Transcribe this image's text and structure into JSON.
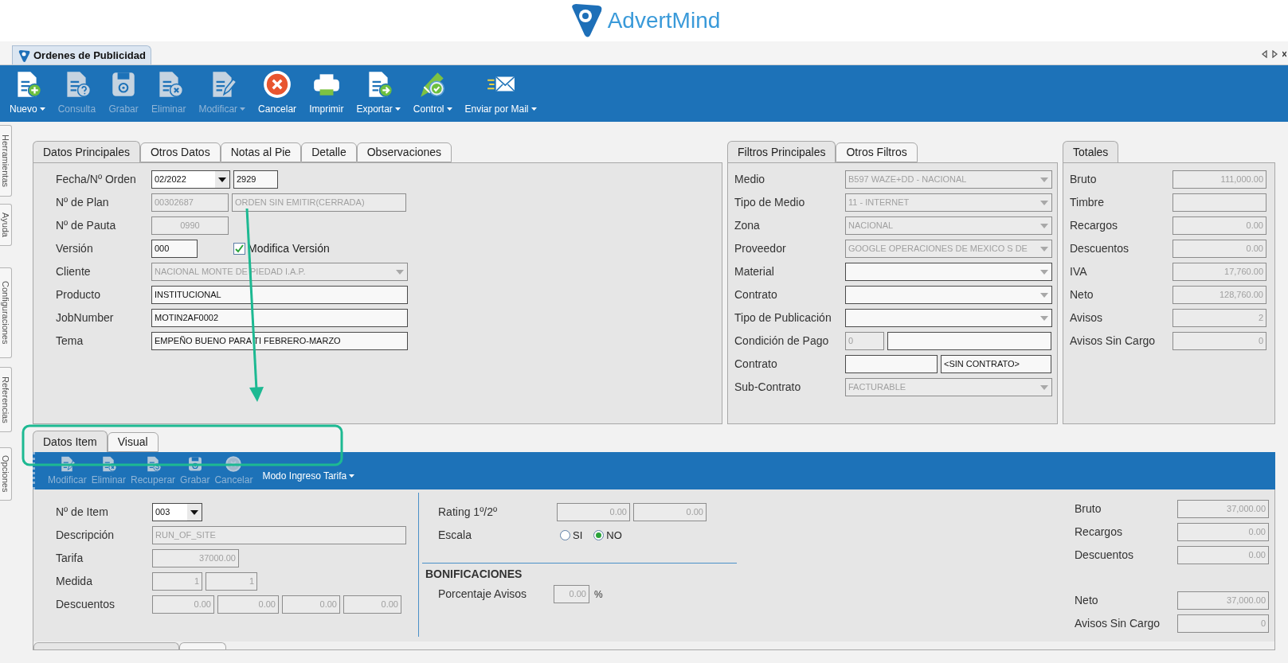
{
  "header": {
    "logo": "AdvertMind"
  },
  "document_tab": {
    "title": "Ordenes de Publicidad"
  },
  "toolbar": [
    {
      "label": "Nuevo",
      "kind": "new",
      "disabled": false,
      "dropdown": true
    },
    {
      "label": "Consulta",
      "kind": "query",
      "disabled": true,
      "dropdown": false
    },
    {
      "label": "Grabar",
      "kind": "save",
      "disabled": true,
      "dropdown": false
    },
    {
      "label": "Eliminar",
      "kind": "delete",
      "disabled": true,
      "dropdown": false
    },
    {
      "label": "Modificar",
      "kind": "edit",
      "disabled": true,
      "dropdown": true
    },
    {
      "label": "Cancelar",
      "kind": "cancel",
      "disabled": false,
      "dropdown": false
    },
    {
      "label": "Imprimir",
      "kind": "print",
      "disabled": false,
      "dropdown": false
    },
    {
      "label": "Exportar",
      "kind": "export",
      "disabled": false,
      "dropdown": true
    },
    {
      "label": "Control",
      "kind": "control",
      "disabled": false,
      "dropdown": true
    },
    {
      "label": "Enviar por Mail",
      "kind": "mail",
      "disabled": false,
      "dropdown": true
    }
  ],
  "side_tabs": [
    "Herramientas",
    "Ayuda",
    "Configuraciones",
    "Referencias",
    "Opciones"
  ],
  "main_panel": {
    "tabs": [
      {
        "label": "Datos Principales",
        "selected": true
      },
      {
        "label": "Otros Datos",
        "selected": false
      },
      {
        "label": "Notas al Pie",
        "selected": false
      },
      {
        "label": "Detalle",
        "selected": false
      },
      {
        "label": "Observaciones",
        "selected": false
      }
    ],
    "rows": [
      {
        "label": "Fecha/Nº Orden",
        "fields": [
          {
            "value": "02/2022",
            "kind": "combo",
            "disabled": false
          },
          {
            "value": "2929",
            "kind": "text",
            "disabled": false
          }
        ]
      },
      {
        "label": "Nº de Plan",
        "fields": [
          {
            "value": "00302687",
            "kind": "text",
            "disabled": true
          },
          {
            "value": "ORDEN SIN EMITIR(CERRADA)",
            "kind": "text",
            "disabled": true
          }
        ]
      },
      {
        "label": "Nº de Pauta",
        "fields": [
          {
            "value": "0990",
            "kind": "code",
            "disabled": true
          }
        ]
      },
      {
        "label": "Versión",
        "fields": [
          {
            "value": "000",
            "kind": "text",
            "disabled": false
          }
        ],
        "checkbox": {
          "label": "Modifica Versión",
          "checked": true
        }
      },
      {
        "label": "Cliente",
        "fields": [
          {
            "value": "NACIONAL MONTE DE PIEDAD I.A.P.",
            "kind": "select",
            "disabled": true
          }
        ]
      },
      {
        "label": "Producto",
        "fields": [
          {
            "value": "INSTITUCIONAL",
            "kind": "text",
            "disabled": false
          }
        ]
      },
      {
        "label": "JobNumber",
        "fields": [
          {
            "value": "MOTIN2AF0002",
            "kind": "text",
            "disabled": false
          }
        ]
      },
      {
        "label": "Tema",
        "fields": [
          {
            "value": "EMPEÑO BUENO PARA TI  FEBRERO-MARZO",
            "kind": "text",
            "disabled": false
          }
        ]
      }
    ]
  },
  "filters_panel": {
    "tabs": [
      {
        "label": "Filtros Principales",
        "selected": true
      },
      {
        "label": "Otros Filtros",
        "selected": false
      }
    ],
    "rows": [
      {
        "label": "Medio",
        "fields": [
          {
            "value": "B597 WAZE+DD - NACIONAL",
            "kind": "select",
            "disabled": true
          }
        ]
      },
      {
        "label": "Tipo de Medio",
        "fields": [
          {
            "value": "11 - INTERNET",
            "kind": "select",
            "disabled": true
          }
        ]
      },
      {
        "label": "Zona",
        "fields": [
          {
            "value": "NACIONAL",
            "kind": "select",
            "disabled": true
          }
        ]
      },
      {
        "label": "Proveedor",
        "fields": [
          {
            "value": "GOOGLE OPERACIONES DE MEXICO S DE",
            "kind": "select",
            "disabled": true
          }
        ]
      },
      {
        "label": "Material",
        "fields": [
          {
            "kind": "select",
            "disabled": false
          }
        ]
      },
      {
        "label": "Contrato",
        "fields": [
          {
            "kind": "select",
            "disabled": false
          }
        ]
      },
      {
        "label": "Tipo de Publicación",
        "fields": [
          {
            "kind": "select",
            "disabled": false
          }
        ]
      },
      {
        "label": "Condición de Pago",
        "fields": [
          {
            "value": "0",
            "kind": "text",
            "disabled": true
          },
          {
            "kind": "text",
            "disabled": false
          }
        ]
      },
      {
        "label": "Contrato",
        "fields": [
          {
            "kind": "text",
            "disabled": false
          },
          {
            "value": "<SIN CONTRATO>",
            "kind": "text",
            "disabled": false
          }
        ]
      },
      {
        "label": "Sub-Contrato",
        "fields": [
          {
            "value": "FACTURABLE",
            "kind": "select",
            "disabled": true
          }
        ]
      }
    ]
  },
  "totals_panel": {
    "tabs": [
      {
        "label": "Totales",
        "selected": true
      }
    ],
    "rows": [
      {
        "label": "Bruto",
        "fields": [
          {
            "value": "111,000.00",
            "kind": "number",
            "disabled": true
          }
        ]
      },
      {
        "label": "Timbre",
        "fields": [
          {
            "kind": "number",
            "disabled": true
          }
        ]
      },
      {
        "label": "Recargos",
        "fields": [
          {
            "value": "0.00",
            "kind": "number",
            "disabled": true
          }
        ]
      },
      {
        "label": "Descuentos",
        "fields": [
          {
            "value": "0.00",
            "kind": "number",
            "disabled": true
          }
        ]
      },
      {
        "label": "IVA",
        "fields": [
          {
            "value": "17,760.00",
            "kind": "number",
            "disabled": true
          }
        ]
      },
      {
        "label": "Neto",
        "fields": [
          {
            "value": "128,760.00",
            "kind": "number",
            "disabled": true
          }
        ]
      },
      {
        "label": "Avisos",
        "fields": [
          {
            "value": "2",
            "kind": "number",
            "disabled": true
          }
        ]
      },
      {
        "label": "Avisos Sin Cargo",
        "fields": [
          {
            "value": "0",
            "kind": "number",
            "disabled": true
          }
        ]
      }
    ]
  },
  "item_panel": {
    "tabs": [
      {
        "label": "Datos Item",
        "selected": true
      },
      {
        "label": "Visual",
        "selected": false
      }
    ],
    "toolbar": [
      {
        "label": "Modificar",
        "kind": "edit",
        "disabled": true,
        "dropdown": false
      },
      {
        "label": "Eliminar",
        "kind": "delete",
        "disabled": true,
        "dropdown": false
      },
      {
        "label": "Recuperar",
        "kind": "recover",
        "disabled": true,
        "dropdown": false
      },
      {
        "label": "Grabar",
        "kind": "save",
        "disabled": true,
        "dropdown": false
      },
      {
        "label": "Cancelar",
        "kind": "cancel",
        "disabled": true,
        "dropdown": false
      },
      {
        "label": "Modo Ingreso Tarifa",
        "kind": "menu",
        "disabled": false,
        "dropdown": true
      }
    ],
    "rows": [
      {
        "label": "Nº de Item",
        "fields": [
          {
            "value": "003",
            "kind": "combo",
            "disabled": false
          }
        ]
      },
      {
        "label": "Descripción",
        "fields": [
          {
            "value": "RUN_OF_SITE",
            "kind": "text",
            "disabled": true
          }
        ]
      },
      {
        "label": "Tarifa",
        "fields": [
          {
            "value": "37000.00",
            "kind": "number",
            "disabled": true
          }
        ]
      },
      {
        "label": "Medida",
        "fields": [
          {
            "value": "1",
            "kind": "number",
            "disabled": true
          },
          {
            "value": "1",
            "kind": "number",
            "disabled": true
          }
        ]
      },
      {
        "label": "Descuentos",
        "fields": [
          {
            "value": "0.00",
            "kind": "number",
            "disabled": true
          },
          {
            "value": "0.00",
            "kind": "number",
            "disabled": true
          },
          {
            "value": "0.00",
            "kind": "number",
            "disabled": true
          },
          {
            "value": "0.00",
            "kind": "number",
            "disabled": true
          }
        ]
      }
    ],
    "middle_rows": [
      {
        "label": "Rating 1º/2º",
        "fields": [
          {
            "value": "0.00",
            "kind": "number",
            "disabled": true
          },
          {
            "value": "0.00",
            "kind": "number",
            "disabled": true
          }
        ]
      },
      {
        "label": "Escala",
        "radios": [
          {
            "label": "SI",
            "selected": false
          },
          {
            "label": "NO",
            "selected": true
          }
        ]
      }
    ],
    "bonificaciones": {
      "title": "BONIFICACIONES",
      "rows": [
        {
          "label": "Porcentaje Avisos",
          "fields": [
            {
              "value": "0.00",
              "kind": "number",
              "disabled": true
            }
          ],
          "unit": "%"
        }
      ]
    },
    "totals": [
      [
        {
          "label": "Bruto",
          "fields": [
            {
              "value": "37,000.00",
              "kind": "number",
              "disabled": true
            }
          ]
        },
        {
          "label": "Recargos",
          "fields": [
            {
              "value": "0.00",
              "kind": "number",
              "disabled": true
            }
          ]
        },
        {
          "label": "Descuentos",
          "fields": [
            {
              "value": "0.00",
              "kind": "number",
              "disabled": true
            }
          ]
        }
      ],
      [
        {
          "label": "Neto",
          "fields": [
            {
              "value": "37,000.00",
              "kind": "number",
              "disabled": true
            }
          ]
        },
        {
          "label": "Avisos Sin Cargo",
          "fields": [
            {
              "value": "0",
              "kind": "number",
              "disabled": true
            }
          ]
        }
      ]
    ]
  }
}
